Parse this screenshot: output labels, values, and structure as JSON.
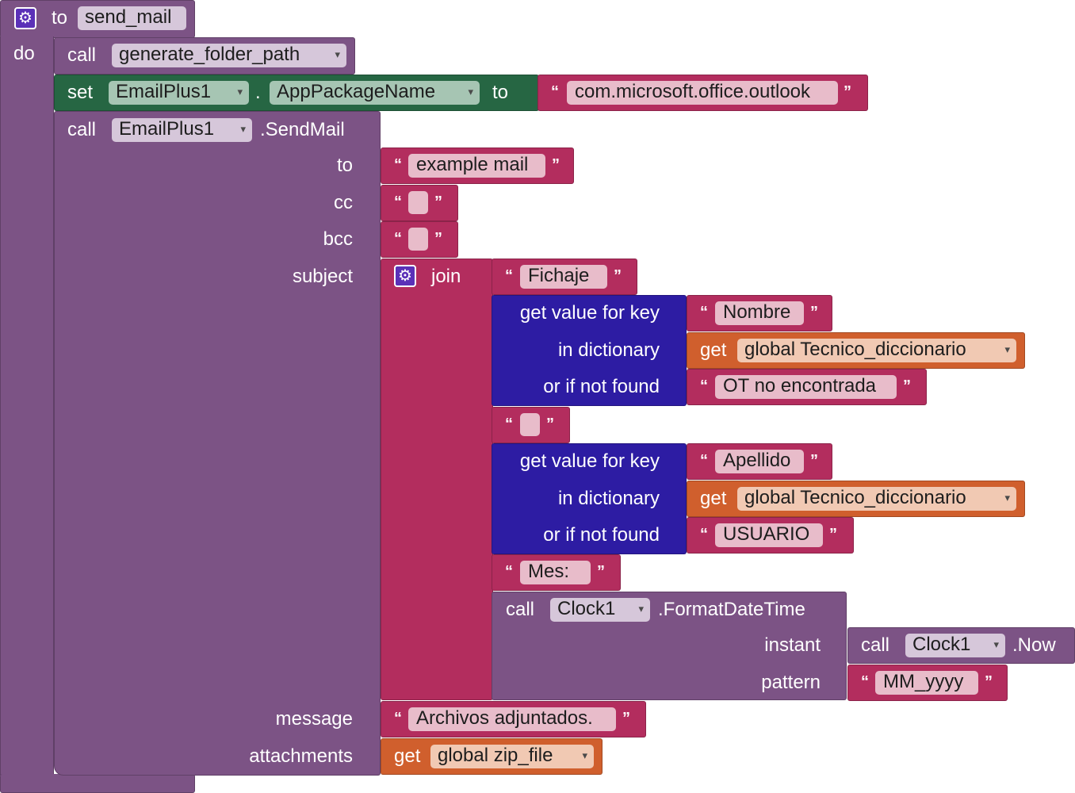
{
  "procedure": {
    "keyword_to": "to",
    "name": "send_mail",
    "keyword_do": "do"
  },
  "call_generate": {
    "keyword": "call",
    "procedure": "generate_folder_path"
  },
  "set_block": {
    "keyword": "set",
    "component": "EmailPlus1",
    "dot": ".",
    "property": "AppPackageName",
    "keyword_to": "to",
    "value": "com.microsoft.office.outlook"
  },
  "sendmail": {
    "keyword": "call",
    "component": "EmailPlus1",
    "method": ".SendMail",
    "params": {
      "to": "to",
      "cc": "cc",
      "bcc": "bcc",
      "subject": "subject",
      "message": "message",
      "attachments": "attachments"
    },
    "to_value": "example mail",
    "message_value": "Archivos adjuntados.",
    "attachments": {
      "keyword": "get",
      "variable": "global zip_file"
    }
  },
  "join": {
    "label": "join",
    "item1": "Fichaje",
    "lookup1": {
      "get_label": "get value for key",
      "in_label": "in dictionary",
      "notfound_label": "or if not found",
      "key": "Nombre",
      "dict_get": "get",
      "dict_var": "global Tecnico_diccionario",
      "notfound": "OT no encontrada"
    },
    "lookup2": {
      "get_label": "get value for key",
      "in_label": "in dictionary",
      "notfound_label": "or if not found",
      "key": "Apellido",
      "dict_get": "get",
      "dict_var": "global Tecnico_diccionario",
      "notfound": "USUARIO"
    },
    "item_mes": "Mes:",
    "format": {
      "keyword": "call",
      "component": "Clock1",
      "method": ".FormatDateTime",
      "instant_label": "instant",
      "pattern_label": "pattern",
      "now_keyword": "call",
      "now_component": "Clock1",
      "now_method": ".Now",
      "pattern_value": "MM_yyyy"
    }
  },
  "glyphs": {
    "open_quote": "“",
    "close_quote": "”",
    "dropdown": "▾",
    "gear": "⚙"
  },
  "colors": {
    "procedure": "#7c5385",
    "text": "#b32d5e",
    "dictionary": "#2d1ca3",
    "variable": "#d05f2d",
    "setter": "#266643"
  }
}
